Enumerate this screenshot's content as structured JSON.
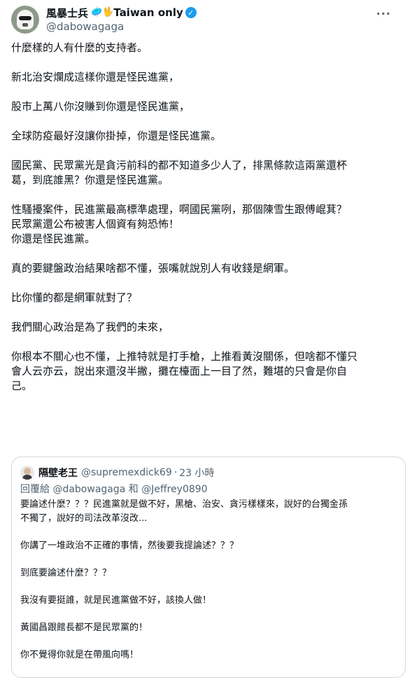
{
  "author": {
    "display_name": "風暴士兵",
    "emoji": "🥏🖖",
    "suffix": "Taiwan only",
    "handle": "@dabowagaga"
  },
  "icons": {
    "more": "more-options-icon",
    "verified": "verified-badge-icon"
  },
  "colors": {
    "verified": "#1d9bf0",
    "secondary_text": "#536471",
    "border": "#cfd9de"
  },
  "tweet": {
    "paragraphs": [
      "什麼樣的人有什麼的支持者。",
      "新北治安爛成這樣你還是怪民進黨，",
      "股市上萬八你沒賺到你還是怪民進黨，",
      "全球防疫最好沒讓你掛掉，你還是怪民進黨。",
      "國民黨、民眾黨光是貪污前科的都不知道多少人了，排黑條款這兩黨還杯\n葛，到底誰黑？你還是怪民進黨。",
      "性騷擾案件，民進黨最高標準處理，啊國民黨咧，那個陳雪生跟傅崐萁？\n民眾黨還公布被害人個資有夠恐怖！\n你還是怪民進黨。",
      "真的要鍵盤政治結果啥都不懂，張嘴就說別人有收錢是網軍。",
      "比你懂的都是網軍就對了？",
      "我們關心政治是為了我們的未來，",
      "你根本不關心也不懂，上推特就是打手槍，上推看黃沒關係，但啥都不懂只\n會人云亦云，說出來還沒半撇，攤在檯面上一目了然，難堪的只會是你自\n己。"
    ]
  },
  "quote": {
    "name": "隔壁老王",
    "handle": "@supremexdick69",
    "dot": "·",
    "time": "23 小時",
    "reply_prefix": "回覆給",
    "reply_to": "@dabowagaga 和 @Jeffrey0890",
    "paragraphs": [
      "要論述什麼？？？民進黨就是做不好，黑槍、治安、貪污樣樣來，說好的台獨金孫\n不獨了，說好的司法改革沒改...",
      "你講了一堆政治不正確的事情，然後要我提論述？？？",
      "到底要論述什麼？？？",
      "我沒有要挺誰，就是民進黨做不好，該換人做！",
      "黃國昌跟館長都不是民眾黨的！",
      "你不覺得你就是在帶風向嗎！"
    ]
  }
}
